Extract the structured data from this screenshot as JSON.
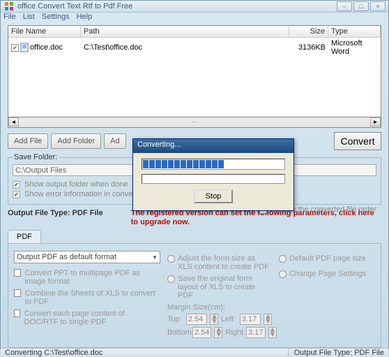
{
  "window": {
    "title": "office Convert Text Rtf to Pdf Free"
  },
  "menu": {
    "file": "File",
    "list": "List",
    "settings": "Settings",
    "help": "Help"
  },
  "table": {
    "headers": {
      "file": "File Name",
      "path": "Path",
      "size": "Size",
      "type": "Type"
    },
    "rows": [
      {
        "checked": true,
        "file": "office.doc",
        "path": "C:\\Test\\office.doc",
        "size": "3136KB",
        "type": "Microsoft Word"
      }
    ]
  },
  "buttons": {
    "addFile": "Add File",
    "addFolder": "Add Folder",
    "ad": "Ad",
    "convert": "Convert"
  },
  "saveFolder": {
    "legend": "Save Folder:",
    "path": "C:\\Output Files",
    "showFolder": "Show output folder when done",
    "showError": "Show error information in convers"
  },
  "includeOrder": "Include the converted file order",
  "outputType": {
    "label": "Output File Type:  PDF File"
  },
  "upgradeMsg": "The registered version can set the following parameters, click here to upgrade now.",
  "tabs": {
    "pdf": "PDF"
  },
  "pdfOptions": {
    "combo": "Output PDF as default format",
    "convPPT": "Convert PPT to multipage PDF as image format",
    "combineXLS": "Combine the Sheets of XLS to convert to PDF",
    "eachPage": "Convert each page content of DOC/RTF to single PDF",
    "adjustForm": "Adjust the form size as XLS content to create PDF",
    "saveLayout": "Save the original form layout of XLS to create PDF",
    "marginLabel": "Margin Size(cm):",
    "top": "Top",
    "topVal": "2.54",
    "left": "Left",
    "leftVal": "3.17",
    "bottom": "Bottom",
    "bottomVal": "2.54",
    "right": "Right",
    "rightVal": "3.17",
    "defaultSize": "Default PDF page size",
    "changePage": "Change Page Settings"
  },
  "dialog": {
    "title": "Converting...",
    "stop": "Stop"
  },
  "status": {
    "left": "Converting  C:\\Test\\office.doc",
    "right": "Output File Type:  PDF File"
  }
}
